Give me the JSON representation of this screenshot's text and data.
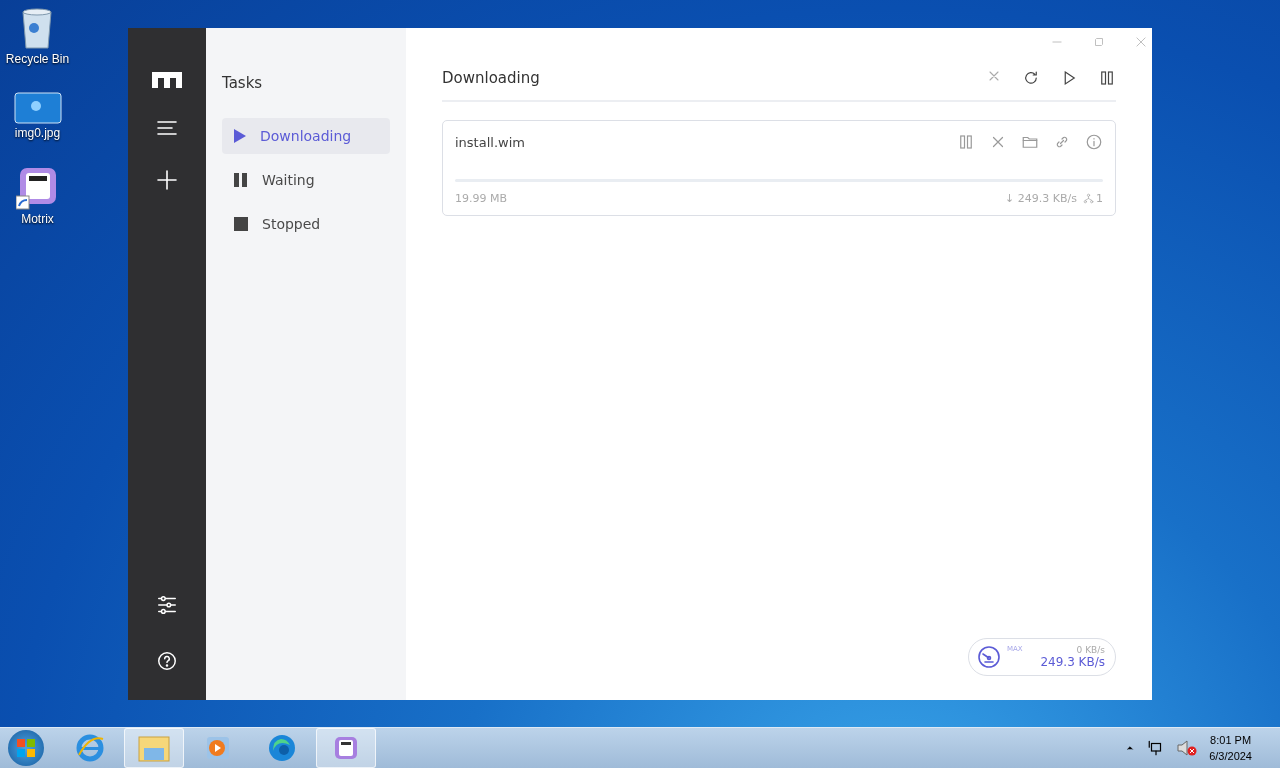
{
  "desktop_icons": [
    {
      "label": "Recycle Bin",
      "kind": "bin"
    },
    {
      "label": "img0.jpg",
      "kind": "image"
    },
    {
      "label": "Motrix",
      "kind": "app"
    }
  ],
  "window": {
    "sidebar_title": "Tasks",
    "nav": [
      {
        "label": "Downloading",
        "kind": "play",
        "selected": true
      },
      {
        "label": "Waiting",
        "kind": "pause",
        "selected": false
      },
      {
        "label": "Stopped",
        "kind": "stop",
        "selected": false
      }
    ],
    "header": "Downloading",
    "tasks": [
      {
        "name": "install.wim",
        "level": 0,
        "size": "19.99 MB",
        "speed": "↓ 249.3 KB/s",
        "connections": "1"
      }
    ],
    "speedometer": {
      "label": "MAX",
      "upload": "0 KB/s",
      "download": "249.3 KB/s"
    }
  },
  "taskbar": {
    "apps": [
      {
        "kind": "ie",
        "active": false
      },
      {
        "kind": "explorer",
        "active": true
      },
      {
        "kind": "media",
        "active": false
      },
      {
        "kind": "edge",
        "active": false
      },
      {
        "kind": "motrix",
        "active": true
      }
    ],
    "time": "8:01 PM",
    "date": "6/3/2024"
  }
}
